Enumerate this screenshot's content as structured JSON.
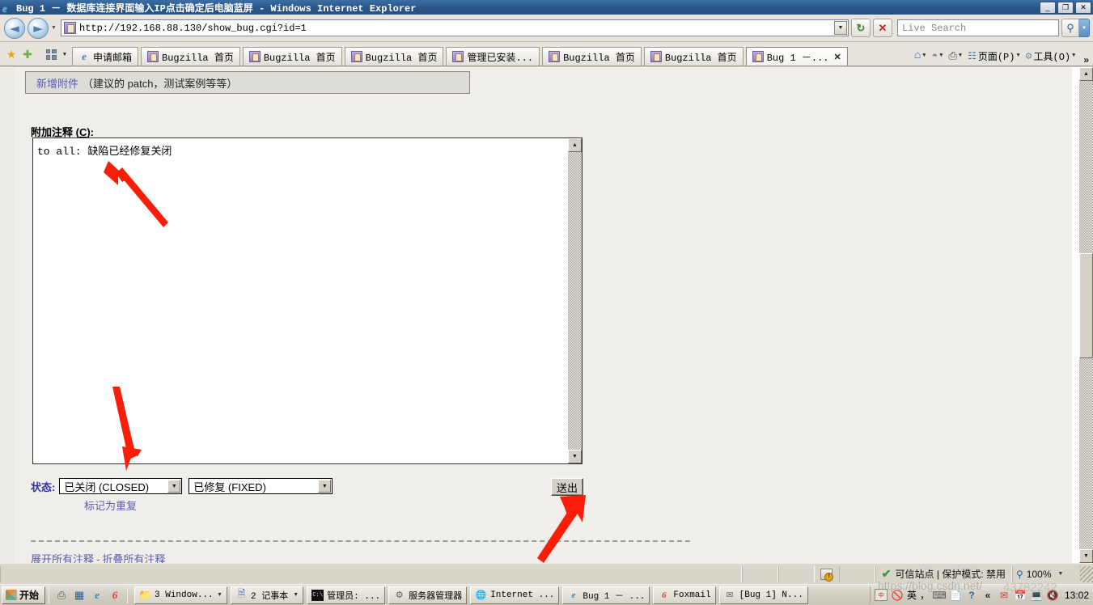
{
  "window": {
    "title": "Bug 1 － 数据库连接界面输入IP点击确定后电脑蓝屏 - Windows Internet Explorer",
    "minimize_label": "_",
    "restore_label": "❐",
    "close_label": "✕",
    "ie_icon": "ie-logo-icon"
  },
  "address_bar": {
    "back_label": "◄",
    "forward_label": "►",
    "history_caret": "▼",
    "url": "http://192.168.88.130/show_bug.cgi?id=1",
    "url_dropdown_caret": "▼",
    "refresh_label": "↻",
    "stop_label": "✕",
    "search_placeholder": "Live Search",
    "search_go_icon": "magnifier-icon",
    "search_dropdown_caret": "▼"
  },
  "tabbar": {
    "favorites_star": "★",
    "add_favorites_star": "✚",
    "quick_tabs_caret": "▼",
    "tabs": [
      {
        "label": "申请邮箱",
        "icon": "ie-logo-icon",
        "active": false,
        "closable": false
      },
      {
        "label": "Bugzilla 首页",
        "icon": "bugzilla-icon",
        "active": false,
        "closable": false
      },
      {
        "label": "Bugzilla 首页",
        "icon": "bugzilla-icon",
        "active": false,
        "closable": false
      },
      {
        "label": "Bugzilla 首页",
        "icon": "bugzilla-icon",
        "active": false,
        "closable": false
      },
      {
        "label": "管理已安装...",
        "icon": "bugzilla-icon",
        "active": false,
        "closable": false
      },
      {
        "label": "Bugzilla 首页",
        "icon": "bugzilla-icon",
        "active": false,
        "closable": false
      },
      {
        "label": "Bugzilla 首页",
        "icon": "bugzilla-icon",
        "active": false,
        "closable": false
      },
      {
        "label": "Bug 1 －...",
        "icon": "bugzilla-icon",
        "active": true,
        "closable": true
      }
    ],
    "close_glyph": "✕",
    "commands": {
      "home": "home-icon",
      "feeds": "rss-icon",
      "print": "printer-icon",
      "page_label": "页面(P)",
      "tools_label": "工具(O)",
      "overflow": "»",
      "caret": "▼"
    }
  },
  "page": {
    "attachment": {
      "link_label": "新增附件",
      "note": "（建议的 patch，测试案例等等）"
    },
    "comment": {
      "label_prefix": "附加注释 (",
      "label_accesskey": "C",
      "label_suffix": "):",
      "textarea_value": "to all: 缺陷已经修复关闭",
      "scroll_up": "▲",
      "scroll_down": "▼"
    },
    "status": {
      "label": "状态:",
      "resolution_select_value": "已关闭 (CLOSED)",
      "detail_select_value": "已修复 (FIXED)",
      "select_caret": "▼",
      "mark_duplicate_link": "标记为重复"
    },
    "submit_button": "送出",
    "footer": {
      "expand_all": "展开所有注释",
      "separator": "-",
      "collapse_all": "折叠所有注释"
    },
    "annotations": {
      "arrow_color": "#ff2400",
      "arrow_1": "arrow-pointing-to-comment-text",
      "arrow_2": "arrow-pointing-to-status-select",
      "arrow_3": "arrow-pointing-to-submit-button"
    }
  },
  "scrollbar": {
    "up_arrow": "▲",
    "down_arrow": "▼"
  },
  "statusbar": {
    "security_icon": "protected-mode-icon",
    "trusted_check": "✔",
    "zone_text": "可信站点  |  保护模式: 禁用",
    "zoom_icon": "zoom-magnifier-icon",
    "zoom_level": "100%",
    "zoom_caret": "▼"
  },
  "taskbar": {
    "start_label": "开始",
    "quick_launch": [
      {
        "name": "printer-icon",
        "glyph": "🖶"
      },
      {
        "name": "show-desktop-icon",
        "glyph": "▭"
      },
      {
        "name": "internet-explorer-icon",
        "glyph": "e"
      },
      {
        "name": "foxmail-icon",
        "glyph": "6"
      }
    ],
    "items": [
      {
        "label": "3 Window...",
        "icon": "folder-icon",
        "has_caret": true
      },
      {
        "label": "2 记事本",
        "icon": "notepad-icon",
        "has_caret": true
      },
      {
        "label": "管理员: ...",
        "icon": "command-prompt-icon",
        "has_caret": false
      },
      {
        "label": "服务器管理器",
        "icon": "server-manager-icon",
        "has_caret": false
      },
      {
        "label": "Internet ...",
        "icon": "internet-icon",
        "has_caret": false
      },
      {
        "label": "Bug 1 － ...",
        "icon": "internet-explorer-icon",
        "has_caret": false
      },
      {
        "label": "Foxmail",
        "icon": "foxmail-icon",
        "has_caret": false
      },
      {
        "label": "[Bug 1] N...",
        "icon": "mail-icon",
        "has_caret": false
      }
    ],
    "tray": {
      "icons": [
        "ime-mode-icon",
        "block-icon",
        "keyboard-icon",
        "document-icon",
        "help-icon",
        "overflow-icon",
        "mail-alert-icon",
        "calendar-icon",
        "network-icon",
        "volume-muted-icon"
      ],
      "ime_label": "英",
      "ime_comma": "，",
      "overflow": "«",
      "time": "13:02"
    }
  },
  "watermark": {
    "text": "https://blog.csdn.net/",
    "id": "43782242"
  }
}
